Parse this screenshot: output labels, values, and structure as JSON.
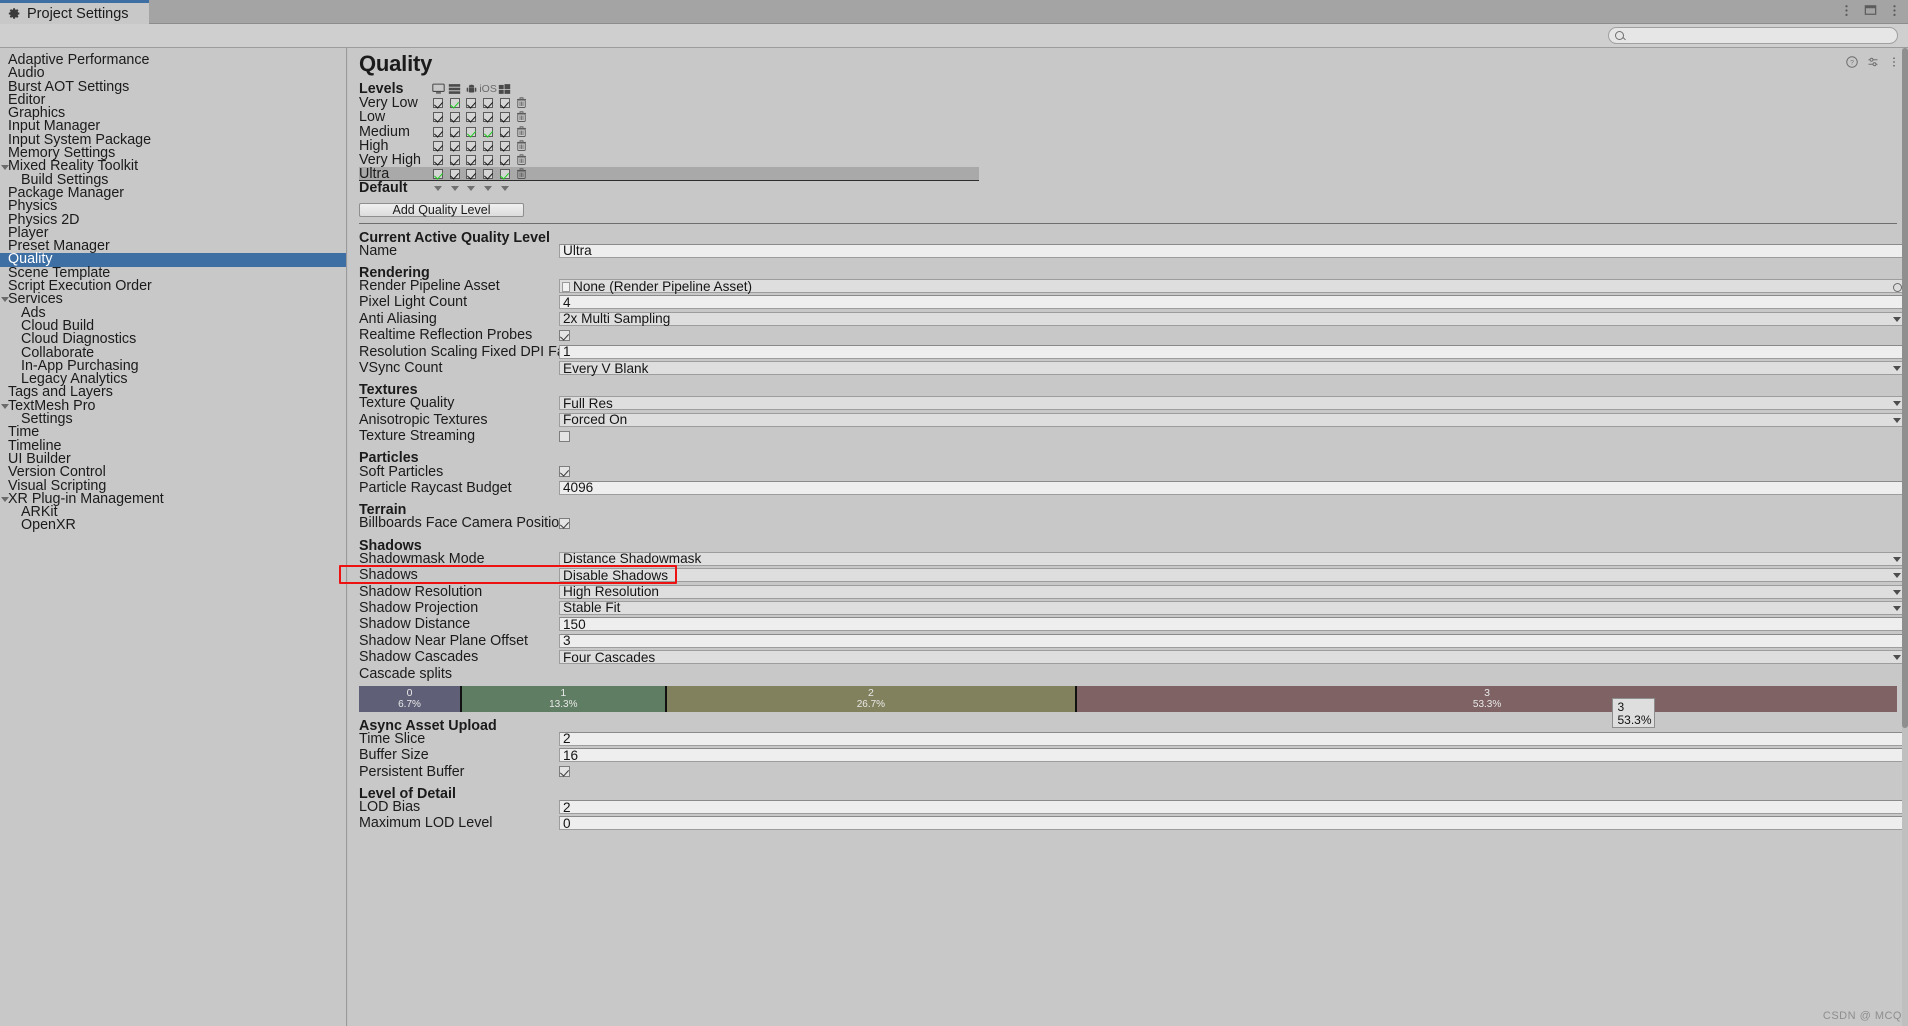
{
  "window": {
    "tab_title": "Project Settings",
    "tab_icon": "gear-icon",
    "buttons": [
      "more-options-icon",
      "maximize-icon",
      "menu-icon"
    ]
  },
  "search": {
    "value": "",
    "placeholder": "",
    "icon": "search-icon"
  },
  "sidebar": {
    "items": [
      {
        "label": "Adaptive Performance",
        "indent": 0,
        "arrow": false,
        "selected": false
      },
      {
        "label": "Audio",
        "indent": 0,
        "arrow": false,
        "selected": false
      },
      {
        "label": "Burst AOT Settings",
        "indent": 0,
        "arrow": false,
        "selected": false
      },
      {
        "label": "Editor",
        "indent": 0,
        "arrow": false,
        "selected": false
      },
      {
        "label": "Graphics",
        "indent": 0,
        "arrow": false,
        "selected": false
      },
      {
        "label": "Input Manager",
        "indent": 0,
        "arrow": false,
        "selected": false
      },
      {
        "label": "Input System Package",
        "indent": 0,
        "arrow": false,
        "selected": false
      },
      {
        "label": "Memory Settings",
        "indent": 0,
        "arrow": false,
        "selected": false
      },
      {
        "label": "Mixed Reality Toolkit",
        "indent": 0,
        "arrow": true,
        "selected": false
      },
      {
        "label": "Build Settings",
        "indent": 1,
        "arrow": false,
        "selected": false
      },
      {
        "label": "Package Manager",
        "indent": 0,
        "arrow": false,
        "selected": false
      },
      {
        "label": "Physics",
        "indent": 0,
        "arrow": false,
        "selected": false
      },
      {
        "label": "Physics 2D",
        "indent": 0,
        "arrow": false,
        "selected": false
      },
      {
        "label": "Player",
        "indent": 0,
        "arrow": false,
        "selected": false
      },
      {
        "label": "Preset Manager",
        "indent": 0,
        "arrow": false,
        "selected": false
      },
      {
        "label": "Quality",
        "indent": 0,
        "arrow": false,
        "selected": true
      },
      {
        "label": "Scene Template",
        "indent": 0,
        "arrow": false,
        "selected": false
      },
      {
        "label": "Script Execution Order",
        "indent": 0,
        "arrow": false,
        "selected": false
      },
      {
        "label": "Services",
        "indent": 0,
        "arrow": true,
        "selected": false
      },
      {
        "label": "Ads",
        "indent": 1,
        "arrow": false,
        "selected": false
      },
      {
        "label": "Cloud Build",
        "indent": 1,
        "arrow": false,
        "selected": false
      },
      {
        "label": "Cloud Diagnostics",
        "indent": 1,
        "arrow": false,
        "selected": false
      },
      {
        "label": "Collaborate",
        "indent": 1,
        "arrow": false,
        "selected": false
      },
      {
        "label": "In-App Purchasing",
        "indent": 1,
        "arrow": false,
        "selected": false
      },
      {
        "label": "Legacy Analytics",
        "indent": 1,
        "arrow": false,
        "selected": false
      },
      {
        "label": "Tags and Layers",
        "indent": 0,
        "arrow": false,
        "selected": false
      },
      {
        "label": "TextMesh Pro",
        "indent": 0,
        "arrow": true,
        "selected": false
      },
      {
        "label": "Settings",
        "indent": 1,
        "arrow": false,
        "selected": false
      },
      {
        "label": "Time",
        "indent": 0,
        "arrow": false,
        "selected": false
      },
      {
        "label": "Timeline",
        "indent": 0,
        "arrow": false,
        "selected": false
      },
      {
        "label": "UI Builder",
        "indent": 0,
        "arrow": false,
        "selected": false
      },
      {
        "label": "Version Control",
        "indent": 0,
        "arrow": false,
        "selected": false
      },
      {
        "label": "Visual Scripting",
        "indent": 0,
        "arrow": false,
        "selected": false
      },
      {
        "label": "XR Plug-in Management",
        "indent": 0,
        "arrow": true,
        "selected": false
      },
      {
        "label": "ARKit",
        "indent": 1,
        "arrow": false,
        "selected": false
      },
      {
        "label": "OpenXR",
        "indent": 1,
        "arrow": false,
        "selected": false
      }
    ]
  },
  "main": {
    "title": "Quality",
    "levels": {
      "header_label": "Levels",
      "platform_icons": [
        "standalone-icon",
        "server-icon",
        "android-icon",
        "ios-icon",
        "windows-store-icon"
      ],
      "ios_text": "iOS",
      "rows": [
        {
          "name": "Very Low",
          "checks": [
            true,
            true,
            true,
            true,
            true
          ],
          "green": [
            false,
            true,
            false,
            false,
            false
          ],
          "current": false
        },
        {
          "name": "Low",
          "checks": [
            true,
            true,
            true,
            true,
            true
          ],
          "green": [
            false,
            false,
            false,
            false,
            false
          ],
          "current": false
        },
        {
          "name": "Medium",
          "checks": [
            true,
            true,
            true,
            true,
            true
          ],
          "green": [
            false,
            false,
            true,
            true,
            false
          ],
          "current": false
        },
        {
          "name": "High",
          "checks": [
            true,
            true,
            true,
            true,
            true
          ],
          "green": [
            false,
            false,
            false,
            false,
            false
          ],
          "current": false
        },
        {
          "name": "Very High",
          "checks": [
            true,
            true,
            true,
            true,
            true
          ],
          "green": [
            false,
            false,
            false,
            false,
            false
          ],
          "current": false
        },
        {
          "name": "Ultra",
          "checks": [
            true,
            true,
            true,
            true,
            true
          ],
          "green": [
            true,
            false,
            false,
            false,
            true
          ],
          "current": true
        }
      ],
      "default_label": "Default",
      "trash_icon": "trash-icon"
    },
    "add_button": "Add Quality Level",
    "sections": [
      {
        "heading": "Current Active Quality Level",
        "rows": [
          {
            "label": "Name",
            "type": "text",
            "value": "Ultra"
          }
        ]
      },
      {
        "heading": "Rendering",
        "rows": [
          {
            "label": "Render Pipeline Asset",
            "type": "object",
            "value": "None (Render Pipeline Asset)"
          },
          {
            "label": "Pixel Light Count",
            "type": "text",
            "value": "4"
          },
          {
            "label": "Anti Aliasing",
            "type": "dropdown",
            "value": "2x Multi Sampling"
          },
          {
            "label": "Realtime Reflection Probes",
            "type": "checkbox",
            "value": true
          },
          {
            "label": "Resolution Scaling Fixed DPI Factor",
            "type": "text",
            "value": "1"
          },
          {
            "label": "VSync Count",
            "type": "dropdown",
            "value": "Every V Blank"
          }
        ]
      },
      {
        "heading": "Textures",
        "rows": [
          {
            "label": "Texture Quality",
            "type": "dropdown",
            "value": "Full Res"
          },
          {
            "label": "Anisotropic Textures",
            "type": "dropdown",
            "value": "Forced On"
          },
          {
            "label": "Texture Streaming",
            "type": "checkbox",
            "value": false
          }
        ]
      },
      {
        "heading": "Particles",
        "rows": [
          {
            "label": "Soft Particles",
            "type": "checkbox",
            "value": true
          },
          {
            "label": "Particle Raycast Budget",
            "type": "text",
            "value": "4096"
          }
        ]
      },
      {
        "heading": "Terrain",
        "rows": [
          {
            "label": "Billboards Face Camera Position",
            "type": "checkbox",
            "value": true
          }
        ]
      },
      {
        "heading": "Shadows",
        "rows": [
          {
            "label": "Shadowmask Mode",
            "type": "dropdown",
            "value": "Distance Shadowmask"
          },
          {
            "label": "Shadows",
            "type": "dropdown",
            "value": "Disable Shadows",
            "highlighted": true
          },
          {
            "label": "Shadow Resolution",
            "type": "dropdown",
            "value": "High Resolution"
          },
          {
            "label": "Shadow Projection",
            "type": "dropdown",
            "value": "Stable Fit"
          },
          {
            "label": "Shadow Distance",
            "type": "text",
            "value": "150"
          },
          {
            "label": "Shadow Near Plane Offset",
            "type": "text",
            "value": "3"
          },
          {
            "label": "Shadow Cascades",
            "type": "dropdown",
            "value": "Four Cascades"
          },
          {
            "label": "Cascade splits",
            "type": "plain"
          }
        ]
      }
    ],
    "cascade": {
      "segments": [
        {
          "index": "0",
          "percent": "6.7%",
          "width": 6.7,
          "color": "#5f5f78"
        },
        {
          "index": "1",
          "percent": "13.3%",
          "width": 13.3,
          "color": "#5f7d62"
        },
        {
          "index": "2",
          "percent": "26.7%",
          "width": 26.7,
          "color": "#82815d"
        },
        {
          "index": "3",
          "percent": "53.3%",
          "width": 53.3,
          "color": "#7e6264"
        }
      ],
      "tooltip": {
        "index": "3",
        "percent": "53.3%"
      }
    },
    "sections2": [
      {
        "heading": "Async Asset Upload",
        "rows": [
          {
            "label": "Time Slice",
            "type": "text",
            "value": "2"
          },
          {
            "label": "Buffer Size",
            "type": "text",
            "value": "16"
          },
          {
            "label": "Persistent Buffer",
            "type": "checkbox",
            "value": true
          }
        ]
      },
      {
        "heading": "Level of Detail",
        "rows": [
          {
            "label": "LOD Bias",
            "type": "text",
            "value": "2"
          },
          {
            "label": "Maximum LOD Level",
            "type": "text",
            "value": "0"
          }
        ]
      }
    ]
  },
  "watermark": "CSDN @ MCQ"
}
